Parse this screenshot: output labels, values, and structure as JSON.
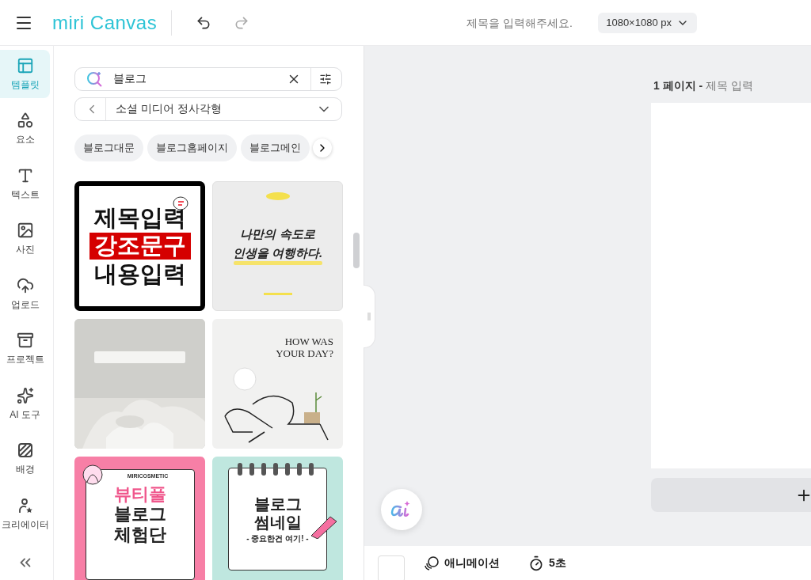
{
  "topbar": {
    "logo": "miri Canvas",
    "title_placeholder": "제목을 입력해주세요.",
    "size": "1080×1080 px"
  },
  "rail": {
    "items": [
      {
        "label": "템플릿",
        "selected": true
      },
      {
        "label": "요소",
        "selected": false
      },
      {
        "label": "텍스트",
        "selected": false
      },
      {
        "label": "사진",
        "selected": false
      },
      {
        "label": "업로드",
        "selected": false
      },
      {
        "label": "프로젝트",
        "selected": false
      },
      {
        "label": "AI 도구",
        "selected": false
      },
      {
        "label": "배경",
        "selected": false
      },
      {
        "label": "크리에이터",
        "selected": false
      }
    ]
  },
  "panel": {
    "search": {
      "value": "블로그"
    },
    "category": "소셜 미디어 정사각형",
    "chips": [
      "블로그대문",
      "블로그홈페이지",
      "블로그메인"
    ],
    "templates": [
      {
        "kind": "bold-text",
        "lines": [
          "제목입력",
          "강조문구",
          "내용입력"
        ]
      },
      {
        "kind": "quote",
        "lines": [
          "나만의 속도로",
          "인생을 여행하다."
        ]
      },
      {
        "kind": "picture"
      },
      {
        "kind": "line-art",
        "lines": [
          "HOW WAS",
          "YOUR DAY?"
        ]
      },
      {
        "kind": "cosmetic",
        "lines": [
          "MIRICOSMETIC",
          "뷰티풀",
          "블로그",
          "체험단"
        ]
      },
      {
        "kind": "notebook",
        "lines": [
          "블로그",
          "썸네일",
          "- 중요한건 여기! -"
        ]
      }
    ]
  },
  "canvas": {
    "page_number": "1 페이지 -",
    "page_title": "제목 입력"
  },
  "bottombar": {
    "animation": "애니메이션",
    "duration": "5초"
  }
}
